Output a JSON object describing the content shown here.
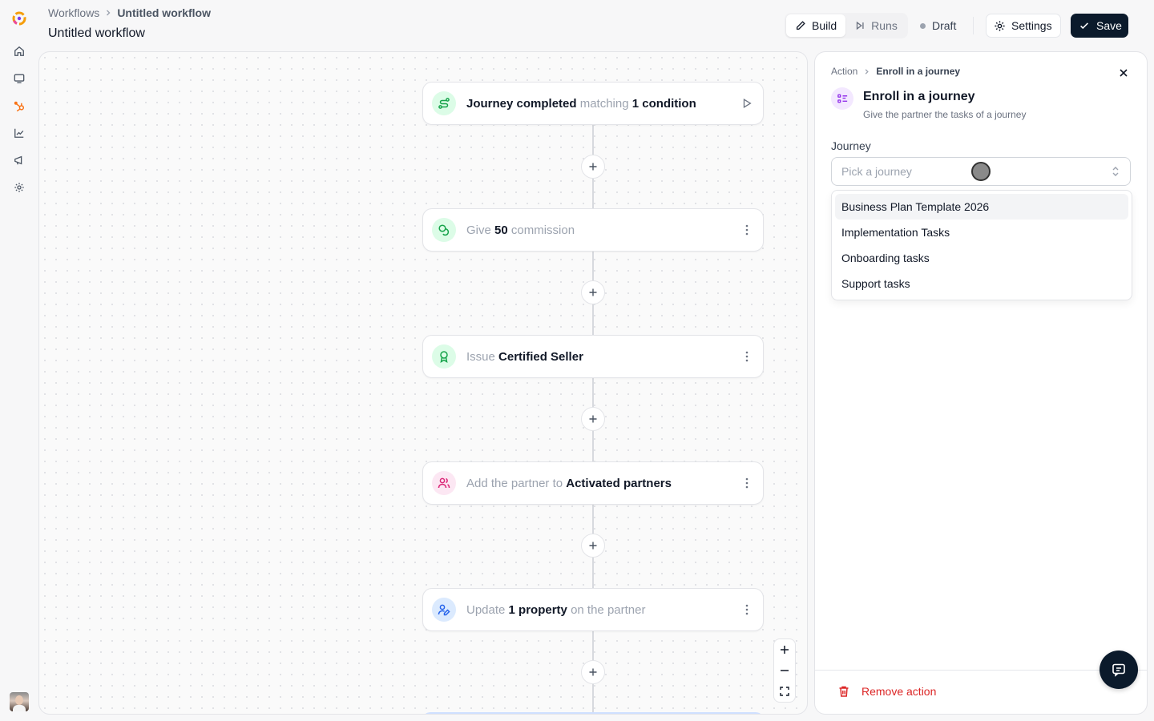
{
  "breadcrumb": {
    "parent": "Workflows",
    "current": "Untitled workflow"
  },
  "page_title": "Untitled workflow",
  "header": {
    "tabs": [
      {
        "label": "Build",
        "active": true
      },
      {
        "label": "Runs",
        "active": false
      }
    ],
    "status": "Draft",
    "settings_label": "Settings",
    "save_label": "Save"
  },
  "nodes": [
    {
      "pre": "",
      "b1": "Journey completed",
      "mid": " matching ",
      "b2": "1 condition",
      "post": "",
      "icon": "route-icon",
      "accent": "#16a34a"
    },
    {
      "pre": "Give ",
      "b1": "50",
      "mid": " commission",
      "b2": "",
      "post": "",
      "icon": "coins-icon",
      "accent": "#16a34a"
    },
    {
      "pre": "Issue ",
      "b1": "Certified Seller",
      "mid": "",
      "b2": "",
      "post": "",
      "icon": "award-icon",
      "accent": "#16a34a"
    },
    {
      "pre": "Add the partner to ",
      "b1": "Activated partners",
      "mid": "",
      "b2": "",
      "post": "",
      "icon": "users-icon",
      "accent": "#db2777"
    },
    {
      "pre": "Update ",
      "b1": "1 property",
      "mid": " on the partner",
      "b2": "",
      "post": "",
      "icon": "user-pen-icon",
      "accent": "#2563eb"
    }
  ],
  "panel": {
    "crumb_parent": "Action",
    "crumb_current": "Enroll in a journey",
    "title": "Enroll in a journey",
    "subtitle": "Give the partner the tasks of a journey",
    "field_label": "Journey",
    "select_placeholder": "Pick a journey",
    "options": [
      "Business Plan Template 2026",
      "Implementation Tasks",
      "Onboarding tasks",
      "Support tasks"
    ],
    "remove_label": "Remove action"
  }
}
